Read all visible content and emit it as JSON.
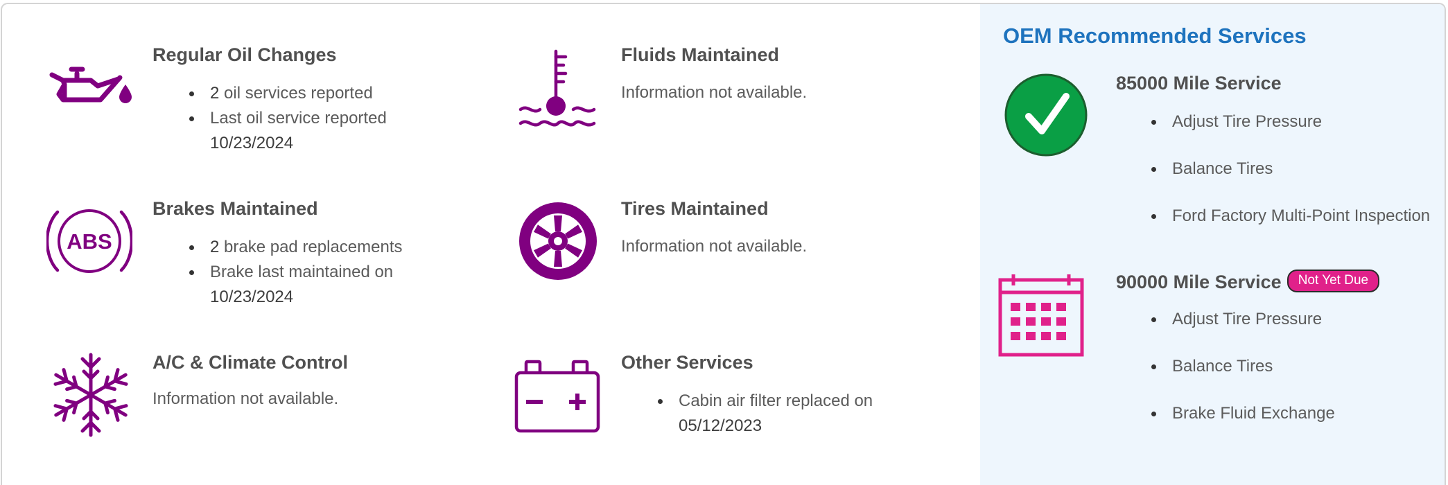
{
  "colors": {
    "icon_purple": "#800080",
    "oem_title_blue": "#1e73be",
    "check_green": "#0a9f45",
    "calendar_pink": "#e0218a",
    "badge_pink": "#e0218a",
    "panel_bg": "#eef6fd"
  },
  "history": {
    "oil": {
      "icon": "oil-can-icon",
      "title": "Regular Oil Changes",
      "b1_count": "2",
      "b1_text": " oil services reported",
      "b2_text": "Last oil service reported",
      "b2_date": "10/23/2024"
    },
    "fluids": {
      "icon": "thermometer-fluid-icon",
      "title": "Fluids Maintained",
      "note": "Information not available."
    },
    "brakes": {
      "icon": "abs-icon",
      "icon_text": "ABS",
      "title": "Brakes Maintained",
      "b1_count": "2",
      "b1_text": " brake pad replacements",
      "b2_text": "Brake last maintained on",
      "b2_date": "10/23/2024"
    },
    "tires": {
      "icon": "tire-icon",
      "title": "Tires Maintained",
      "note": "Information not available."
    },
    "ac": {
      "icon": "snowflake-icon",
      "title": "A/C & Climate Control",
      "note": "Information not available."
    },
    "other": {
      "icon": "battery-icon",
      "title": "Other Services",
      "b1_text": "Cabin air filter replaced on",
      "b1_date": "05/12/2023"
    }
  },
  "oem": {
    "title": "OEM Recommended Services",
    "services": [
      {
        "icon": "checkmark-icon",
        "title": "85000 Mile Service",
        "items": [
          "Adjust Tire Pressure",
          "Balance Tires",
          "Ford Factory Multi-Point Inspection"
        ]
      },
      {
        "icon": "calendar-icon",
        "title": "90000 Mile Service",
        "badge": "Not Yet Due",
        "items": [
          "Adjust Tire Pressure",
          "Balance Tires",
          "Brake Fluid Exchange"
        ]
      }
    ]
  }
}
